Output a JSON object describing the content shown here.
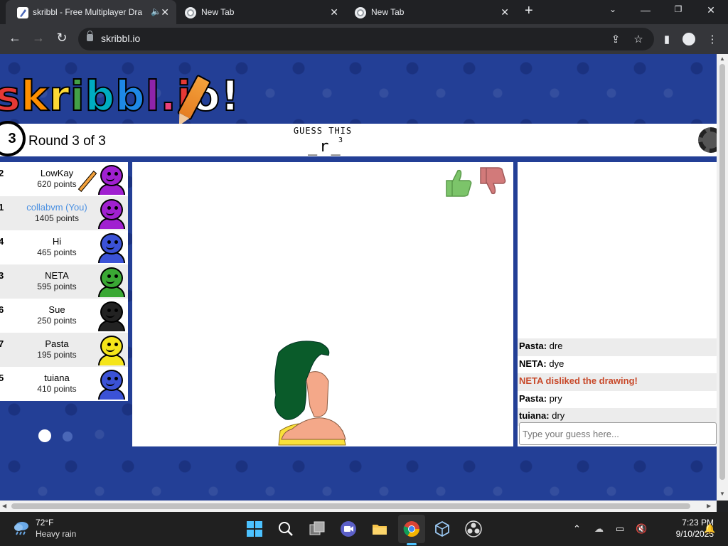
{
  "browser": {
    "tabs": [
      {
        "title": "skribbl - Free Multiplayer Dra",
        "active": true
      },
      {
        "title": "New Tab",
        "active": false
      },
      {
        "title": "New Tab",
        "active": false
      }
    ],
    "new_tab": "+",
    "url": "skribbl.io"
  },
  "game": {
    "logo": [
      "s",
      "k",
      "r",
      "i",
      "b",
      "b",
      "l",
      ".",
      "i",
      "o",
      "!"
    ],
    "logo_colors": [
      "#e53935",
      "#ff8f00",
      "#fdd835",
      "#43a047",
      "#00acc1",
      "#1e88e5",
      "#8e24aa",
      "#ec407a",
      "#e53935",
      "#ffffff",
      "#ffffff"
    ],
    "round_number": "3",
    "round_text": "Round 3 of 3",
    "guess_label": "GUESS THIS",
    "word_hint": "_r_",
    "word_length": "3"
  },
  "players": [
    {
      "rank": "2",
      "name": "LowKay",
      "points": "620 points",
      "color": "#a020d0",
      "drawing": true
    },
    {
      "rank": "1",
      "name": "collabvm (You)",
      "points": "1405 points",
      "color": "#a020d0",
      "you": true
    },
    {
      "rank": "4",
      "name": "Hi",
      "points": "465 points",
      "color": "#3b52d6"
    },
    {
      "rank": "3",
      "name": "NETA",
      "points": "595 points",
      "color": "#3aa834"
    },
    {
      "rank": "6",
      "name": "Sue",
      "points": "250 points",
      "color": "#222222"
    },
    {
      "rank": "7",
      "name": "Pasta",
      "points": "195 points",
      "color": "#f5e51a"
    },
    {
      "rank": "5",
      "name": "tuiana",
      "points": "410 points",
      "color": "#3b52d6"
    }
  ],
  "chat": {
    "messages": [
      {
        "author": "Pasta:",
        "text": "dre"
      },
      {
        "author": "NETA:",
        "text": "dye"
      },
      {
        "author": "",
        "text": "NETA disliked the drawing!",
        "system": true
      },
      {
        "author": "Pasta:",
        "text": "pry"
      },
      {
        "author": "tuiana:",
        "text": "dry"
      }
    ],
    "input_placeholder": "Type your guess here...",
    "dislike_color": "#c8492a"
  },
  "taskbar": {
    "temp": "72°F",
    "weather": "Heavy rain",
    "time": "7:23 PM",
    "date": "9/10/2023"
  }
}
